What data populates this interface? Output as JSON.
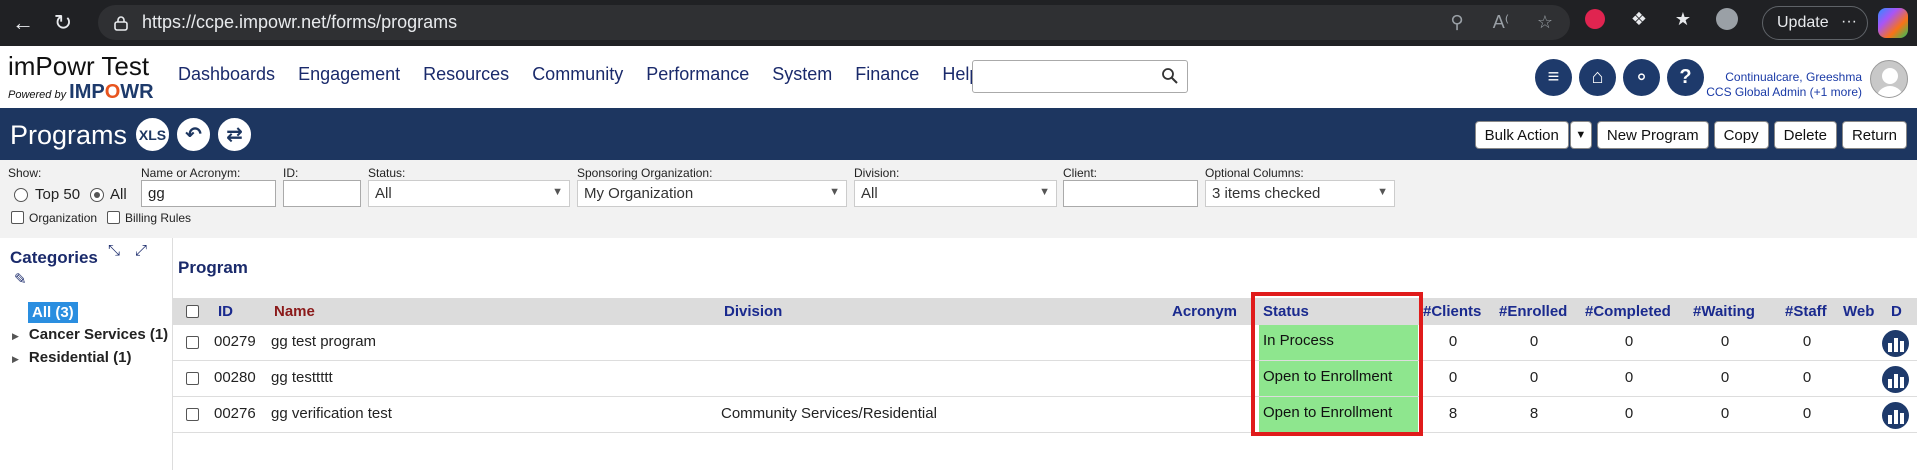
{
  "browser": {
    "url": "https://ccpe.impowr.net/forms/programs",
    "update_label": "Update"
  },
  "header": {
    "logo_title": "imPowr Test",
    "logo_powered": "Powered by",
    "logo_brand_1": "IMP",
    "logo_brand_o": "O",
    "logo_brand_2": "WR",
    "nav": [
      "Dashboards",
      "Engagement",
      "Resources",
      "Community",
      "Performance",
      "System",
      "Finance",
      "Help"
    ],
    "user_name": "Continualcare, Greeshma",
    "user_role": "CCS Global Admin (+1 more)"
  },
  "titlebar": {
    "title": "Programs",
    "xls_label": "XLS",
    "buttons": [
      "Bulk Action",
      "New Program",
      "Copy",
      "Delete",
      "Return"
    ]
  },
  "filters": {
    "show_label": "Show:",
    "top50_label": "Top 50",
    "all_label": "All",
    "name_label": "Name or Acronym:",
    "name_value": "gg",
    "id_label": "ID:",
    "id_value": "",
    "status_label": "Status:",
    "status_value": "All",
    "sponsor_label": "Sponsoring Organization:",
    "sponsor_value": "My Organization",
    "division_label": "Division:",
    "division_value": "All",
    "client_label": "Client:",
    "client_value": "",
    "optional_label": "Optional Columns:",
    "optional_value": "3 items checked",
    "org_check_label": "Organization",
    "billing_check_label": "Billing Rules"
  },
  "sidebar": {
    "title": "Categories",
    "all_label": "All (3)",
    "items": [
      "Cancer Services (1)",
      "Residential (1)"
    ]
  },
  "main": {
    "heading": "Program",
    "columns": {
      "id": "ID",
      "name": "Name",
      "division": "Division",
      "acronym": "Acronym",
      "status": "Status",
      "clients": "#Clients",
      "enrolled": "#Enrolled",
      "completed": "#Completed",
      "waiting": "#Waiting",
      "staff": "#Staff",
      "web": "Web",
      "d": "D"
    },
    "rows": [
      {
        "id": "00279",
        "name": "gg test program",
        "division": "",
        "acronym": "",
        "status": "In Process",
        "clients": "0",
        "enrolled": "0",
        "completed": "0",
        "waiting": "0",
        "staff": "0"
      },
      {
        "id": "00280",
        "name": "gg testtttt",
        "division": "",
        "acronym": "",
        "status": "Open to Enrollment",
        "clients": "0",
        "enrolled": "0",
        "completed": "0",
        "waiting": "0",
        "staff": "0"
      },
      {
        "id": "00276",
        "name": "gg verification test",
        "division": "Community Services/Residential",
        "acronym": "",
        "status": "Open to Enrollment",
        "clients": "8",
        "enrolled": "8",
        "completed": "0",
        "waiting": "0",
        "staff": "0"
      }
    ]
  },
  "colors": {
    "navy": "#1d3660",
    "status_green": "#8ee68e",
    "highlight_red": "#e01b1b",
    "link_blue": "#1a2a8e"
  }
}
